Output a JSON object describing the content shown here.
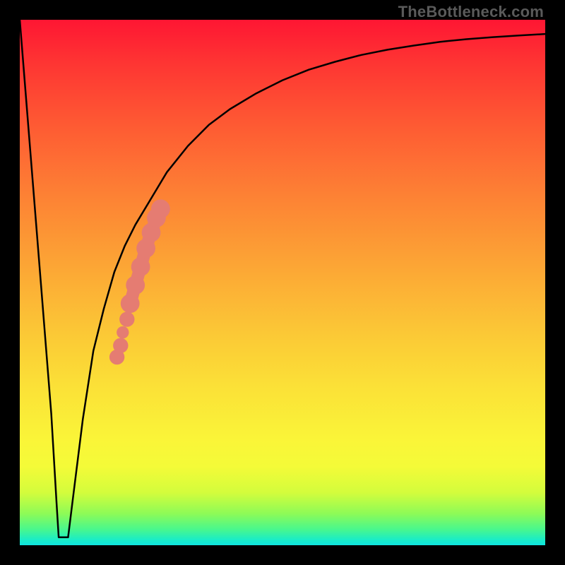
{
  "attribution": "TheBottleneck.com",
  "colors": {
    "frame": "#000000",
    "curve": "#000000",
    "markers": "#e57c72",
    "gradient_top": "#fe1633",
    "gradient_bottom": "#10e4e0"
  },
  "chart_data": {
    "type": "line",
    "title": "",
    "xlabel": "",
    "ylabel": "",
    "xlim": [
      0,
      100
    ],
    "ylim": [
      0,
      100
    ],
    "grid": false,
    "legend": false,
    "series": [
      {
        "name": "bottleneck-curve",
        "x": [
          0,
          2,
          4,
          6,
          7,
          8,
          9,
          10,
          12,
          14,
          16,
          18,
          20,
          22,
          25,
          28,
          32,
          36,
          40,
          45,
          50,
          55,
          60,
          65,
          70,
          75,
          80,
          85,
          90,
          95,
          100
        ],
        "y": [
          100,
          75,
          50,
          25,
          8,
          2,
          2,
          8,
          24,
          37,
          45,
          52,
          57,
          61,
          66,
          71,
          76,
          80,
          83,
          86,
          88.5,
          90.5,
          92,
          93.3,
          94.3,
          95.1,
          95.8,
          96.3,
          96.7,
          97,
          97.3
        ]
      }
    ],
    "flat_segment": {
      "x_start": 7.4,
      "x_end": 9.2,
      "y": 1.5
    },
    "markers": {
      "name": "highlight-band",
      "type": "scatter",
      "shape": "circle",
      "color": "#e57c72",
      "points": [
        {
          "x": 18.5,
          "y": 35.8,
          "r": 1.0
        },
        {
          "x": 19.2,
          "y": 38.0,
          "r": 1.0
        },
        {
          "x": 19.6,
          "y": 40.5,
          "r": 0.7
        },
        {
          "x": 20.4,
          "y": 43.0,
          "r": 1.0
        },
        {
          "x": 21.0,
          "y": 46.0,
          "r": 1.4
        },
        {
          "x": 22.0,
          "y": 49.5,
          "r": 1.4
        },
        {
          "x": 23.0,
          "y": 53.0,
          "r": 1.4
        },
        {
          "x": 24.0,
          "y": 56.5,
          "r": 1.4
        },
        {
          "x": 25.0,
          "y": 59.5,
          "r": 1.4
        },
        {
          "x": 26.0,
          "y": 62.3,
          "r": 1.4
        },
        {
          "x": 26.8,
          "y": 64.0,
          "r": 1.4
        }
      ]
    }
  }
}
